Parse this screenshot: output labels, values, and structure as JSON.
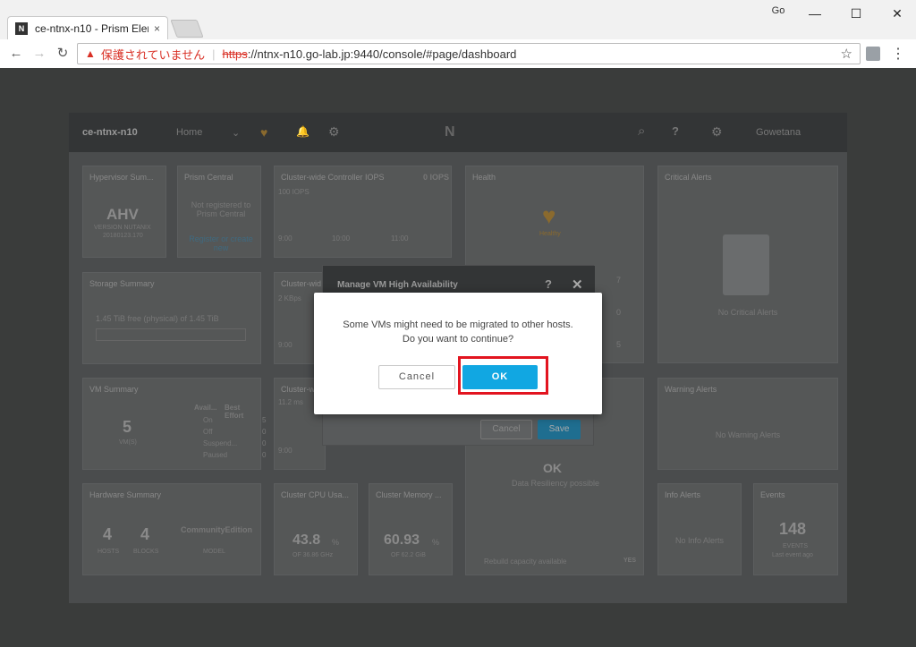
{
  "browser": {
    "tab_title": "ce-ntnx-n10 - Prism Elem",
    "favicon_text": "N",
    "address": {
      "insecure_label": "保護されていません",
      "scheme": "https",
      "url_rest": "://ntnx-n10.go-lab.jp:9440/console/#page/dashboard"
    },
    "icons": {
      "back": "←",
      "forward": "→",
      "reload": "↻",
      "star": "☆",
      "menu": "⋮",
      "profile": "Go",
      "warning": "▲",
      "tab_close": "×"
    },
    "window_controls": {
      "minimize": "—",
      "maximize": "☐",
      "close": "✕"
    }
  },
  "app": {
    "nav": {
      "cluster_name": "ce-ntnx-n10",
      "home_label": "Home",
      "home_chevron": "⌄",
      "health_icon": "♥",
      "bell_icon": "🔔",
      "settings_icon": "⚙",
      "logo_text": "N",
      "search_icon": "⌕",
      "help_label": "?",
      "user_name": "Gowetana"
    },
    "panels": {
      "hypervisor": {
        "title": "Hypervisor Sum...",
        "value": "AHV",
        "version_label": "VERSION NUTANIX",
        "version": "20180123.170"
      },
      "prism_central": {
        "title": "Prism Central",
        "status": "Not registered to Prism Central",
        "link": "Register or create new"
      },
      "controller_iops": {
        "title": "Cluster-wide Controller IOPS",
        "value": "0 IOPS",
        "axis_label": "100 IOPS",
        "times": [
          "9:00",
          "10:00",
          "11:00"
        ]
      },
      "health": {
        "title": "Health",
        "status": "Healthy",
        "counts": [
          "7",
          "0",
          "5"
        ]
      },
      "critical_alerts": {
        "title": "Critical Alerts",
        "empty_text": "No Critical Alerts"
      },
      "storage": {
        "title": "Storage Summary",
        "text": "1.45 TiB free (physical) of 1.45 TiB"
      },
      "controller_bw": {
        "title": "Cluster-wid",
        "axis_label": "2 KBps",
        "time": "9:00"
      },
      "vm_summary": {
        "title": "VM Summary",
        "count": "5",
        "count_label": "VM(S)",
        "col1": "Avail...",
        "col2": "Best Effort",
        "rows": [
          {
            "label": "On",
            "value": "5"
          },
          {
            "label": "Off",
            "value": "0"
          },
          {
            "label": "Suspend...",
            "value": "0"
          },
          {
            "label": "Paused",
            "value": "0"
          }
        ]
      },
      "latency": {
        "title": "Cluster-w",
        "axis_label": "11.2 ms",
        "time": "9:00"
      },
      "warning_alerts": {
        "title": "Warning Alerts",
        "empty_text": "No Warning Alerts"
      },
      "resiliency": {
        "status": "OK",
        "label": "Data Resiliency possible",
        "rebuild_label": "Rebuild capacity available",
        "rebuild_value": "YES"
      },
      "hardware": {
        "title": "Hardware Summary",
        "hosts": "4",
        "hosts_label": "HOSTS",
        "blocks": "4",
        "blocks_label": "BLOCKS",
        "model": "CommunityEdition",
        "model_label": "MODEL"
      },
      "cpu": {
        "title": "Cluster CPU Usa...",
        "value": "43.8",
        "unit": "%",
        "sub": "OF 36.86 GHz"
      },
      "memory": {
        "title": "Cluster Memory ...",
        "value": "60.93",
        "unit": "%",
        "sub": "OF 62.2 GiB"
      },
      "info_alerts": {
        "title": "Info Alerts",
        "empty_text": "No Info Alerts"
      },
      "events": {
        "title": "Events",
        "count": "148",
        "count_label": "EVENTS",
        "sub": "Last event ago"
      }
    }
  },
  "ha_dialog": {
    "title": "Manage VM High Availability",
    "help": "?",
    "close": "✕",
    "cancel_label": "Cancel",
    "save_label": "Save"
  },
  "confirm": {
    "message_line1": "Some VMs might need to be migrated to other hosts.",
    "message_line2": "Do you want to continue?",
    "cancel_label": "Cancel",
    "ok_label": "OK",
    "highlight_color": "#e2141f",
    "ok_color": "#11a7e2"
  }
}
